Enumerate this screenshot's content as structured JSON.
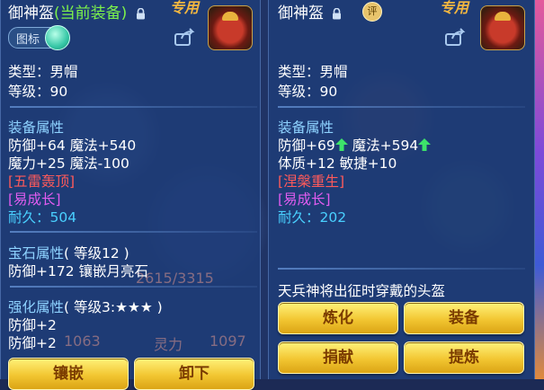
{
  "left_panel": {
    "title": "御神盔",
    "equipped_tag": "(当前装备)",
    "special_tag": "专用",
    "icon_toggle_label": "图标",
    "type": "类型：男帽",
    "level": "等级：90",
    "attr_header": "装备属性",
    "attr_line1": "防御+64 魔法+540",
    "attr_line2": "魔力+25 魔法-100",
    "skill": "[五雷轰顶]",
    "special": "[易成长]",
    "durability_label": "耐久：",
    "durability_value": "504",
    "gem_header": "宝石属性",
    "gem_level": "( 等级12 )",
    "gem_line": "防御+172 镶嵌月亮石",
    "enhance_header": "强化属性",
    "enhance_level": "( 等级3:★★★ )",
    "enhance_line1": "防御+2",
    "enhance_line2": "防御+2",
    "button_inlay": "镶嵌",
    "button_unequip": "卸下",
    "bg_numbers": [
      "2615/3315",
      "1063",
      "灵力",
      "1097"
    ]
  },
  "right_panel": {
    "title": "御神盔",
    "rating_badge": "评",
    "special_tag": "专用",
    "type": "类型：男帽",
    "level": "等级：90",
    "attr_header": "装备属性",
    "attr_line1_a": "防御+69",
    "attr_line1_b": "魔法+594",
    "attr_line2": "体质+12 敏捷+10",
    "skill": "[涅槃重生]",
    "special": "[易成长]",
    "durability_label": "耐久：",
    "durability_value": "202",
    "description": "天兵神将出征时穿戴的头盔",
    "button_refine": "炼化",
    "button_equip": "装备",
    "button_donate": "捐献",
    "button_extract": "提炼"
  },
  "colors": {
    "panel_bg": "#1e3c78",
    "section_header": "#8ed2ff",
    "skill_red": "#ff5a5a",
    "special_pink": "#e15cf0",
    "durability_cyan": "#49d0ff",
    "equipped_green": "#7cf24b",
    "button_gold": "#f2c632"
  }
}
